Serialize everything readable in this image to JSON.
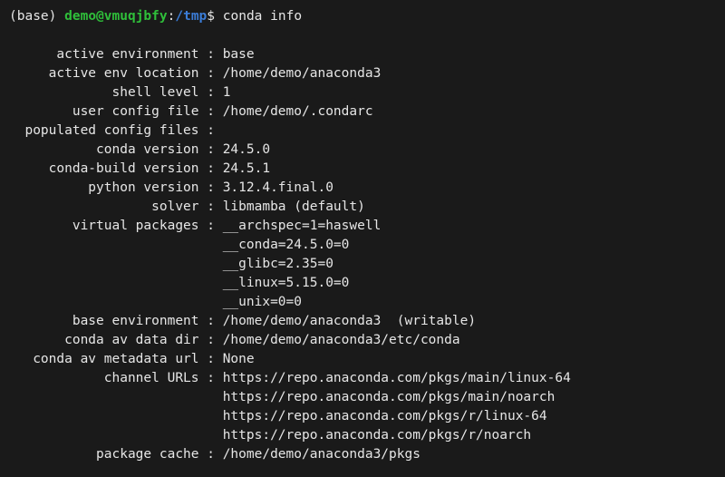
{
  "prompt": {
    "env": "(base)",
    "user": "demo",
    "host": "vmuqjbfy",
    "cwd": "/tmp",
    "symbol": "$",
    "command": "conda info"
  },
  "label_width": 24,
  "info": [
    {
      "key": "active environment",
      "values": [
        "base"
      ]
    },
    {
      "key": "active env location",
      "values": [
        "/home/demo/anaconda3"
      ]
    },
    {
      "key": "shell level",
      "values": [
        "1"
      ]
    },
    {
      "key": "user config file",
      "values": [
        "/home/demo/.condarc"
      ]
    },
    {
      "key": "populated config files",
      "values": [
        ""
      ]
    },
    {
      "key": "conda version",
      "values": [
        "24.5.0"
      ]
    },
    {
      "key": "conda-build version",
      "values": [
        "24.5.1"
      ]
    },
    {
      "key": "python version",
      "values": [
        "3.12.4.final.0"
      ]
    },
    {
      "key": "solver",
      "values": [
        "libmamba (default)"
      ]
    },
    {
      "key": "virtual packages",
      "values": [
        "__archspec=1=haswell",
        "__conda=24.5.0=0",
        "__glibc=2.35=0",
        "__linux=5.15.0=0",
        "__unix=0=0"
      ]
    },
    {
      "key": "base environment",
      "values": [
        "/home/demo/anaconda3  (writable)"
      ]
    },
    {
      "key": "conda av data dir",
      "values": [
        "/home/demo/anaconda3/etc/conda"
      ]
    },
    {
      "key": "conda av metadata url",
      "values": [
        "None"
      ]
    },
    {
      "key": "channel URLs",
      "values": [
        "https://repo.anaconda.com/pkgs/main/linux-64",
        "https://repo.anaconda.com/pkgs/main/noarch",
        "https://repo.anaconda.com/pkgs/r/linux-64",
        "https://repo.anaconda.com/pkgs/r/noarch"
      ]
    },
    {
      "key": "package cache",
      "values": [
        "/home/demo/anaconda3/pkgs"
      ]
    }
  ]
}
